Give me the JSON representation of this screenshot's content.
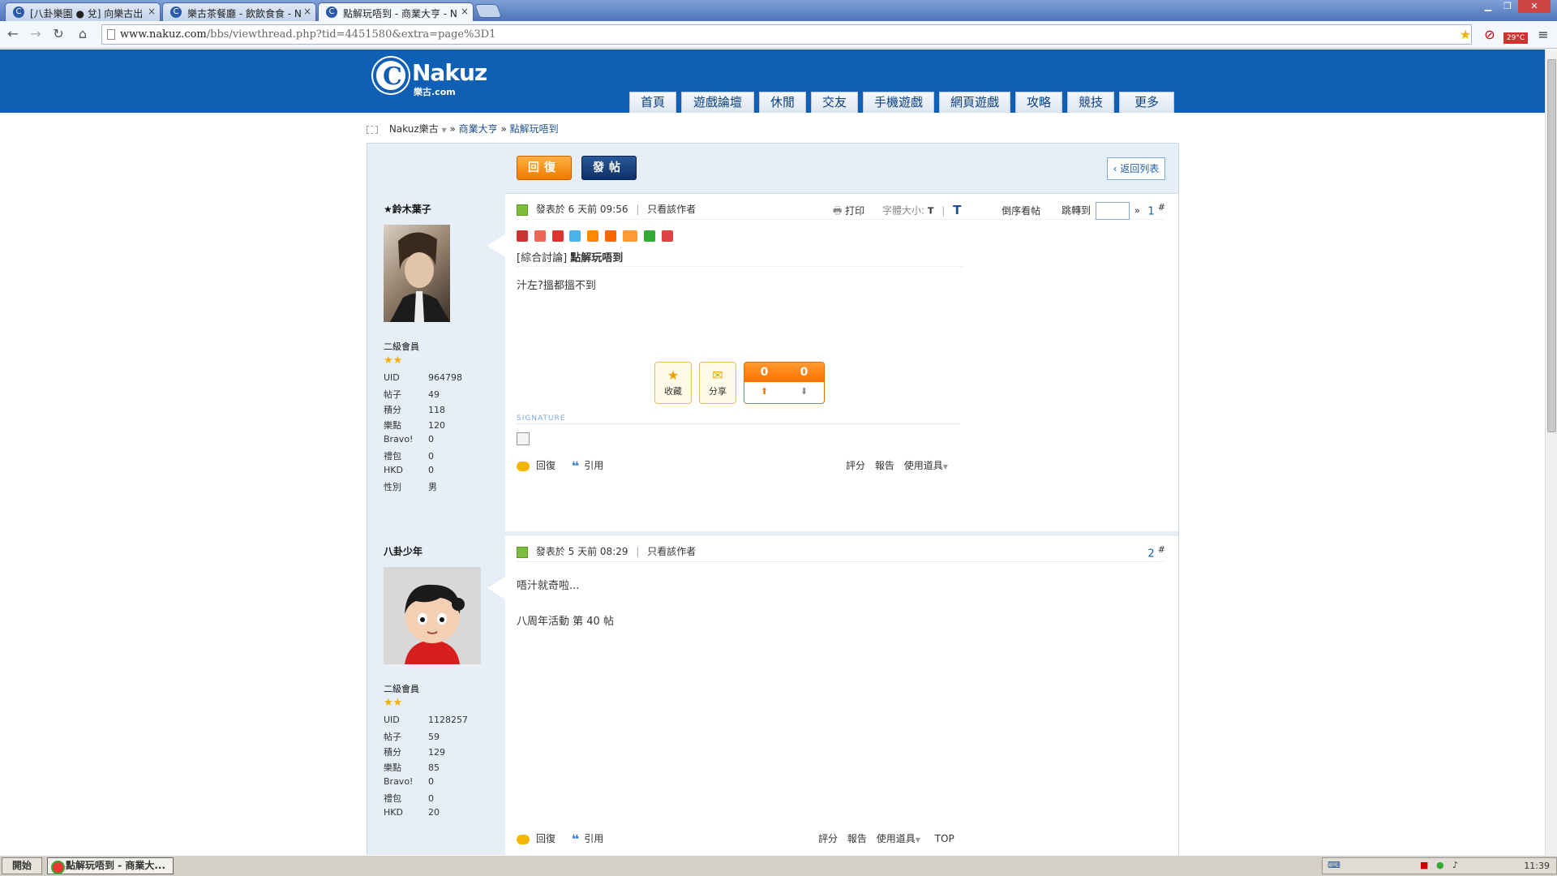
{
  "browser": {
    "tabs": [
      {
        "label": "[八卦樂園 ● 兌] 向樂古出",
        "active": false
      },
      {
        "label": "樂古茶餐廳 - 飲飲食食 - N",
        "active": false
      },
      {
        "label": "點解玩唔到 - 商業大亨 - N",
        "active": true
      }
    ],
    "url_host": "www.nakuz.com",
    "url_path": "/bbs/viewthread.php?tid=4451580&extra=page%3D1",
    "weather": "29°C"
  },
  "site": {
    "logo_word": "Nakuz",
    "logo_sub": "樂古.com",
    "nav": [
      "首頁",
      "遊戲論壇",
      "休閒",
      "交友",
      "手機遊戲",
      "網頁遊戲",
      "攻略",
      "競技",
      "更多"
    ]
  },
  "breadcrumb": {
    "home": "Nakuz樂古",
    "forum": "商業大亨",
    "thread": "點解玩唔到"
  },
  "toolbar": {
    "reply": "回復",
    "post": "發帖",
    "back": "返回列表"
  },
  "users": [
    {
      "name": "★鈴木葉子",
      "group": "二級會員",
      "stars": "★★",
      "stats": [
        {
          "k": "UID",
          "v": "964798"
        },
        {
          "k": "帖子",
          "v": "49"
        },
        {
          "k": "積分",
          "v": "118"
        },
        {
          "k": "樂點",
          "v": "120"
        },
        {
          "k": "Bravo!",
          "v": "0"
        },
        {
          "k": "禮包",
          "v": "0"
        },
        {
          "k": "HKD",
          "v": "0"
        },
        {
          "k": "性別",
          "v": "男"
        }
      ]
    },
    {
      "name": "八卦少年",
      "group": "二級會員",
      "stars": "★★",
      "stats": [
        {
          "k": "UID",
          "v": "1128257"
        },
        {
          "k": "帖子",
          "v": "59"
        },
        {
          "k": "積分",
          "v": "129"
        },
        {
          "k": "樂點",
          "v": "85"
        },
        {
          "k": "Bravo!",
          "v": "0"
        },
        {
          "k": "禮包",
          "v": "0"
        },
        {
          "k": "HKD",
          "v": "20"
        }
      ]
    }
  ],
  "posts": [
    {
      "posted": "發表於 6 天前 09:56",
      "only_author": "只看該作者",
      "print": "打印",
      "font_size_label": "字體大小:",
      "font_small": "T",
      "font_large": "T",
      "reverse": "倒序看帖",
      "goto": "跳轉到",
      "goto_arrow": "»",
      "floor": "1",
      "floor_mark": "#",
      "category": "[綜合討論]",
      "title": "點解玩唔到",
      "body": "汁左?搵都搵不到",
      "favorite": "收藏",
      "share": "分享",
      "support_count": "0",
      "oppose_count": "0",
      "support": "支持",
      "oppose": "反對",
      "signature": "SIGNATURE",
      "reply": "回復",
      "quote": "引用",
      "rate": "評分",
      "report": "報告",
      "tools": "使用道具"
    },
    {
      "posted": "發表於 5 天前 08:29",
      "only_author": "只看該作者",
      "floor": "2",
      "floor_mark": "#",
      "body": "唔汁就奇啦...",
      "extra": "八周年活動 第 40 帖",
      "reply": "回復",
      "quote": "引用",
      "rate": "評分",
      "report": "報告",
      "tools": "使用道具",
      "top": "TOP"
    }
  ],
  "taskbar": {
    "start": "開始",
    "item": "點解玩唔到 - 商業大...",
    "clock": "11:39"
  },
  "colors": {
    "header_blue": "#0f5fb5",
    "accent_orange": "#f07a00",
    "panel_blue": "#e6eef7"
  }
}
